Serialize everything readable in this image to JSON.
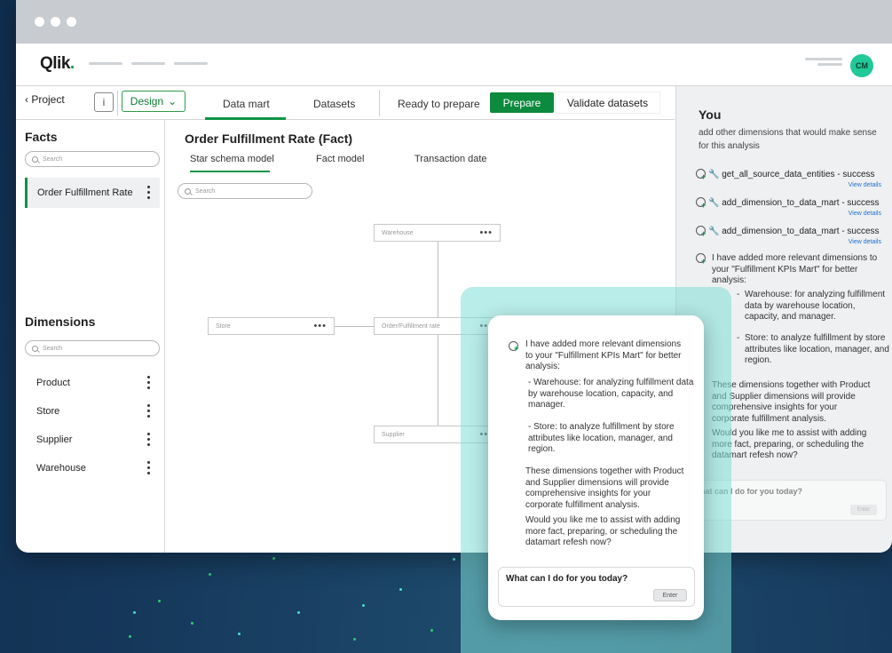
{
  "app": {
    "logo": "Qlik",
    "avatar_initials": "CM"
  },
  "toolbar": {
    "back_label": "Project",
    "info_label": "i",
    "design_label": "Design",
    "tabs": [
      "Data mart",
      "Datasets"
    ],
    "status_text": "Ready to prepare",
    "prepare_label": "Prepare",
    "validate_label": "Validate datasets"
  },
  "facts": {
    "title": "Facts",
    "search_placeholder": "Search",
    "items": [
      "Order Fulfillment Rate"
    ]
  },
  "dimensions": {
    "title": "Dimensions",
    "search_placeholder": "Search",
    "items": [
      "Product",
      "Store",
      "Supplier",
      "Warehouse"
    ]
  },
  "main": {
    "title": "Order Fulfillment Rate (Fact)",
    "sub_tabs": [
      "Star schema model",
      "Fact model",
      "Transaction date"
    ],
    "search_placeholder": "Search",
    "nodes": {
      "warehouse": "Warehouse",
      "store": "Store",
      "fact": "Order/Fulfillment rate",
      "supplier": "Supplier"
    }
  },
  "chat_side": {
    "you_label": "You",
    "user_message": "add other dimensions that would make sense for this analysis",
    "tool_calls": [
      {
        "text": "get_all_source_data_entities - success",
        "link": "View details"
      },
      {
        "text": "add_dimension_to_data_mart - success",
        "link": "View details"
      },
      {
        "text": "add_dimension_to_data_mart - success",
        "link": "View details"
      }
    ],
    "reply_intro": "I have added more relevant dimensions to your \"Fulfillment KPIs Mart\" for better analysis:",
    "bullet_1": "Warehouse: for analyzing fulfillment data by warehouse location, capacity, and manager.",
    "bullet_2": "Store: to analyze fulfillment by store attributes like location, manager, and region.",
    "summary": "These dimensions together with Product and Supplier dimensions will provide comprehensive insights for your corporate fulfillment analysis.",
    "question": "Would you like me to assist with adding more fact, preparing, or scheduling the datamart refesh now?",
    "input_placeholder": "hat can I do for you today?",
    "enter_label": "Enter"
  },
  "chat_card": {
    "reply_intro": "I have added more relevant dimensions to your \"Fulfillment KPIs Mart\" for better analysis:",
    "bullet_1": "- Warehouse: for analyzing fulfillment data by warehouse location, capacity, and manager.",
    "bullet_2": "- Store: to analyze fulfillment by store attributes like location, manager, and region.",
    "summary": "These dimensions together with Product and Supplier dimensions will provide comprehensive insights for your corporate fulfillment analysis.",
    "question": "Would you like me to assist with adding more fact, preparing, or scheduling the datamart refesh now?",
    "input_placeholder": "What can I do for you today?",
    "enter_label": "Enter"
  },
  "colors": {
    "accent_green": "#0c9446",
    "background_navy": "#15375a",
    "overlay_teal": "#80ded7",
    "avatar": "#20c997"
  }
}
